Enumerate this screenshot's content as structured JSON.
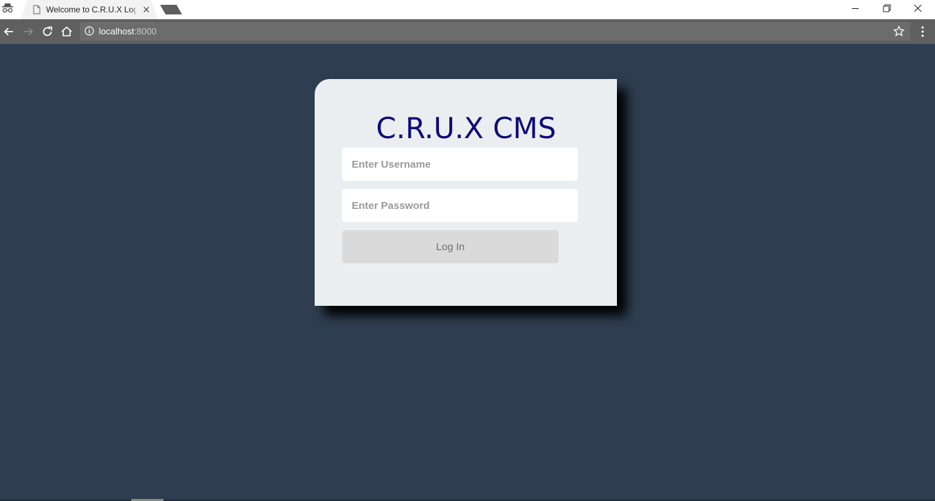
{
  "browser": {
    "tab_title": "Welcome to C.R.U.X Login",
    "tab_close": "✕",
    "url_host": "localhost",
    "url_port": ":8000"
  },
  "login": {
    "brand": "C.R.U.X CMS",
    "username_placeholder": "Enter Username",
    "password_placeholder": "Enter Password",
    "submit_label": "Log In"
  },
  "colors": {
    "page_background": "#2e3d50",
    "card_background": "#ebeef0",
    "brand_text": "#0d0b78",
    "button_background": "#dadada"
  },
  "icons": [
    "incognito-icon",
    "page-icon",
    "close-icon",
    "minimize-icon",
    "restore-icon",
    "back-icon",
    "forward-icon",
    "reload-icon",
    "home-icon",
    "info-icon",
    "star-icon",
    "menu-icon"
  ]
}
